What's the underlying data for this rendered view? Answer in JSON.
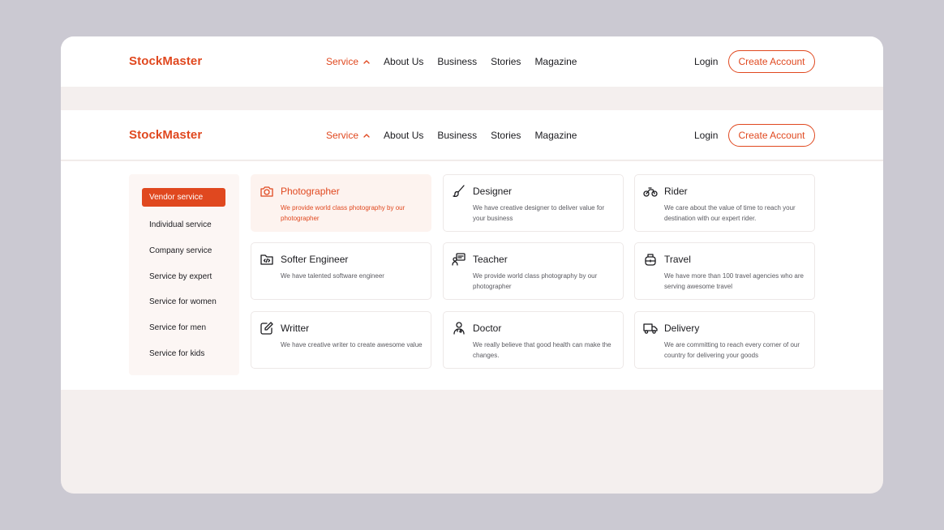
{
  "brand": {
    "name": "StockMaster",
    "accent": "#e0481f"
  },
  "nav": {
    "items": [
      {
        "label": "Service"
      },
      {
        "label": "About Us"
      },
      {
        "label": "Business"
      },
      {
        "label": "Stories"
      },
      {
        "label": "Magazine"
      }
    ],
    "login": "Login",
    "create_account": "Create Account"
  },
  "sidebar": {
    "items": [
      {
        "label": "Vendor service"
      },
      {
        "label": "Individual service"
      },
      {
        "label": "Company service"
      },
      {
        "label": "Service by expert"
      },
      {
        "label": "Service for women"
      },
      {
        "label": "Service for men"
      },
      {
        "label": "Service for kids"
      }
    ]
  },
  "services": [
    {
      "title": "Photographer",
      "desc": "We provide world class photography by our photographer",
      "icon": "camera-icon"
    },
    {
      "title": "Designer",
      "desc": "We have creative designer to deliver value for your business",
      "icon": "brush-icon"
    },
    {
      "title": "Rider",
      "desc": "We care about the value of time to reach your destination with our expert rider.",
      "icon": "bicycle-icon"
    },
    {
      "title": "Softer Engineer",
      "desc": "We have talented software engineer",
      "icon": "code-folder-icon"
    },
    {
      "title": "Teacher",
      "desc": "We provide world class photography by our photographer",
      "icon": "teacher-icon"
    },
    {
      "title": "Travel",
      "desc": "We have more than 100 travel agencies who are serving awesome travel",
      "icon": "luggage-icon"
    },
    {
      "title": "Writter",
      "desc": "We have creative writer to create awesome value",
      "icon": "edit-icon"
    },
    {
      "title": "Doctor",
      "desc": "We really believe that good health can make the changes.",
      "icon": "doctor-icon"
    },
    {
      "title": "Delivery",
      "desc": "We are committing to reach every corner of our country for delivering your goods",
      "icon": "truck-icon"
    }
  ]
}
